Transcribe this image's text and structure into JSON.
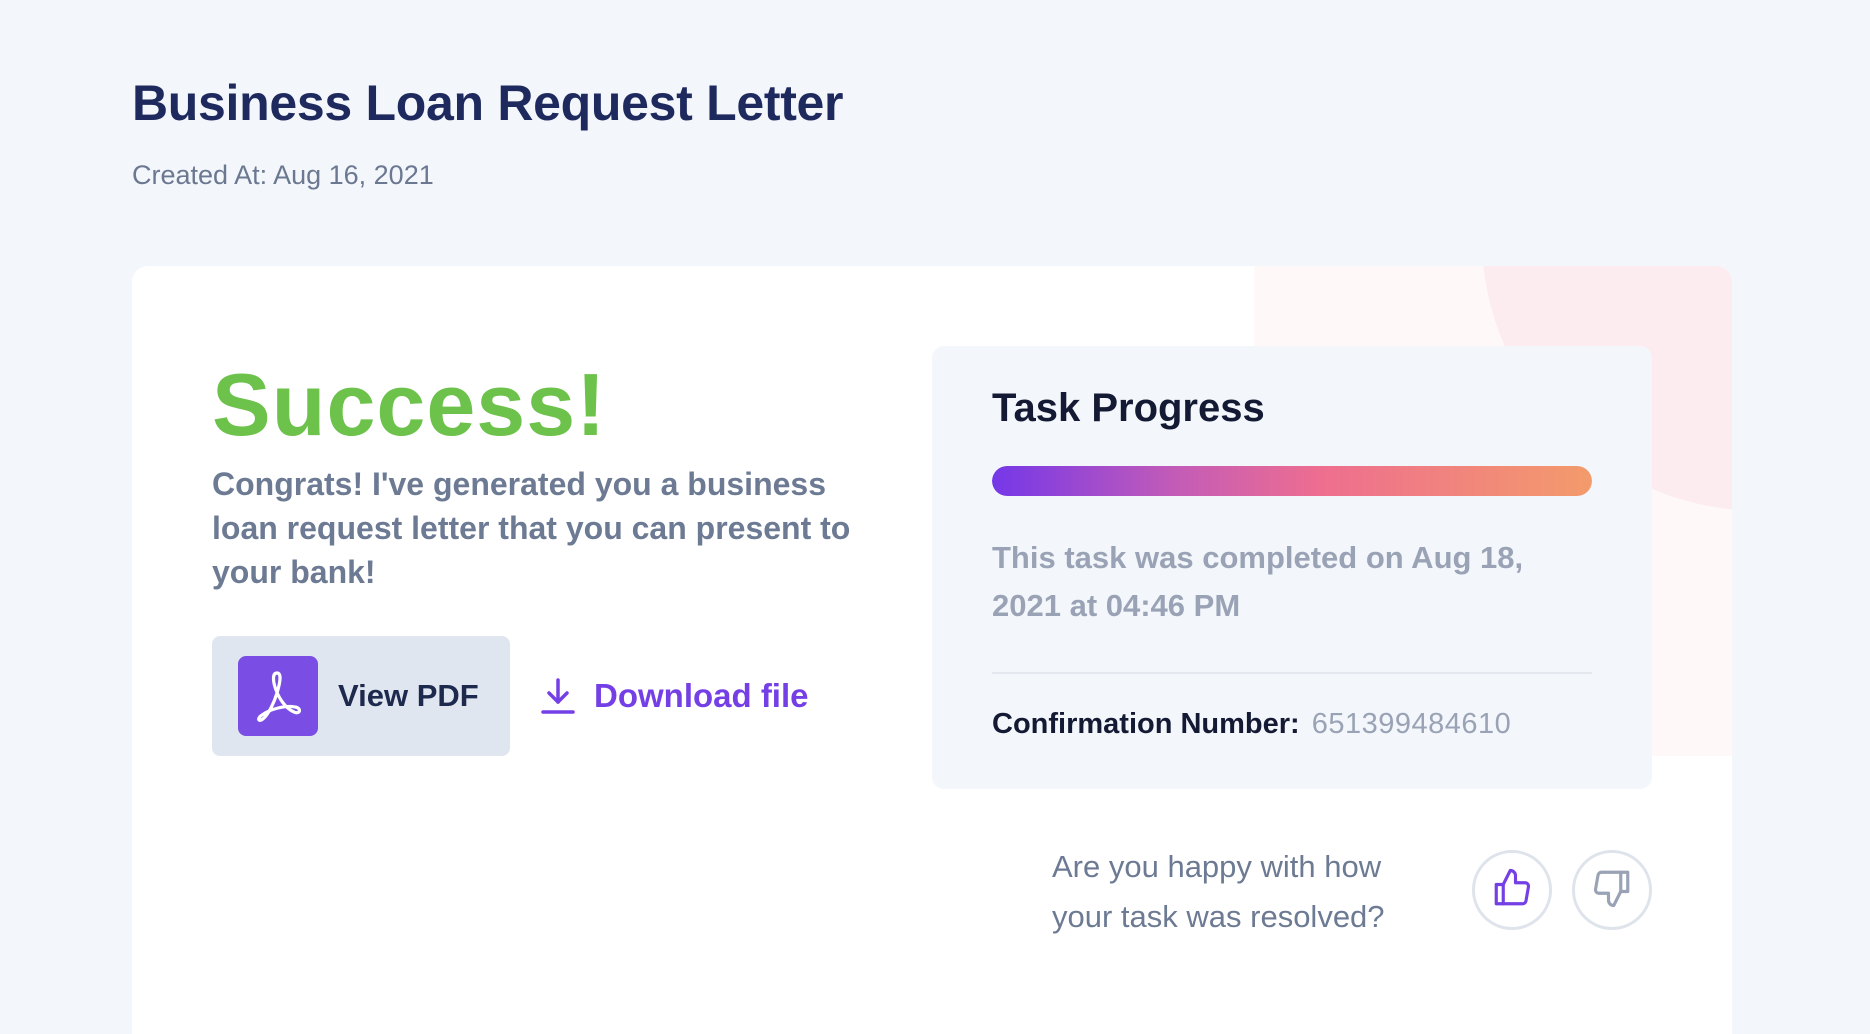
{
  "header": {
    "title": "Business Loan Request Letter",
    "created_at": "Created At: Aug 16, 2021"
  },
  "result": {
    "heading": "Success!",
    "message": "Congrats! I've generated you a business loan request letter that you can present to your bank!",
    "view_pdf_label": "View PDF",
    "download_label": "Download file",
    "accent_color": "#7440e6",
    "success_color": "#6cc24a"
  },
  "progress": {
    "title": "Task Progress",
    "percent": 100,
    "completed_text": "This task was completed on Aug 18, 2021 at 04:46 PM",
    "confirmation_label": "Confirmation Number:",
    "confirmation_value": "651399484610"
  },
  "feedback": {
    "question": "Are you happy with how your task was resolved?",
    "thumbs_up_icon": "thumbs-up-icon",
    "thumbs_down_icon": "thumbs-down-icon"
  }
}
